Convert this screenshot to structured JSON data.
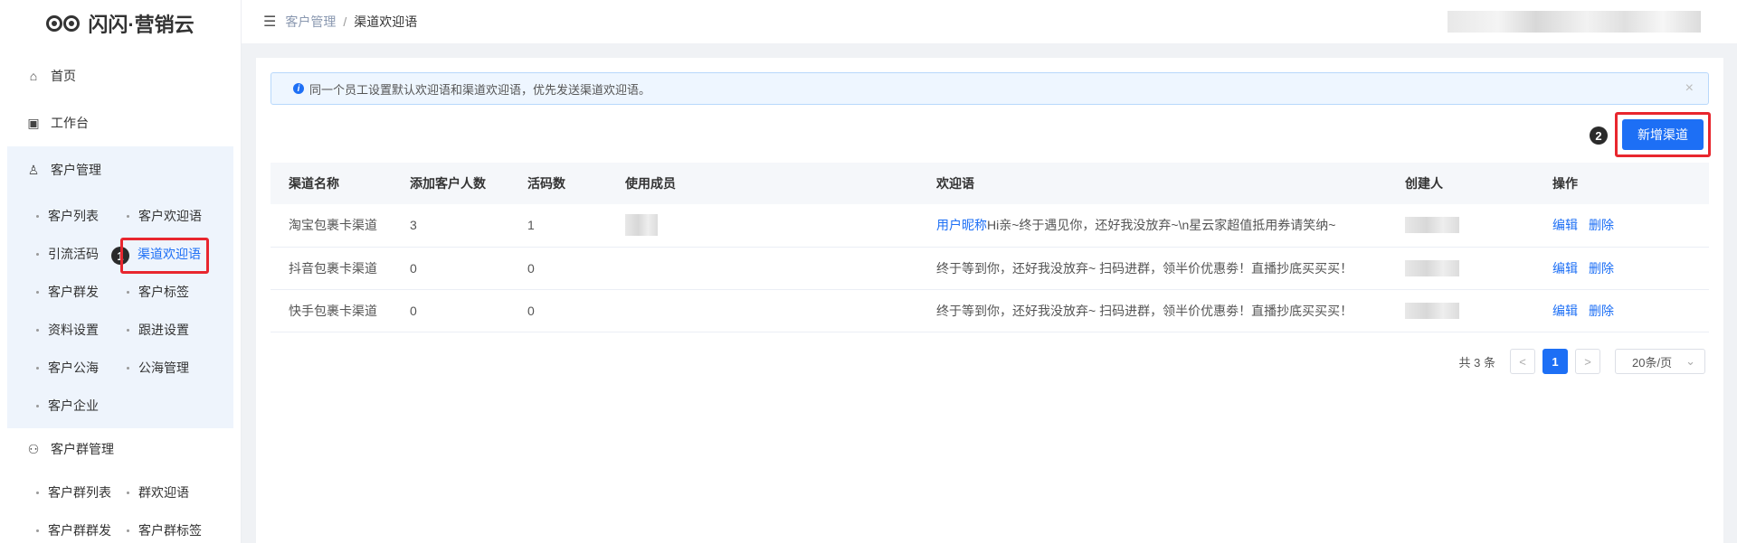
{
  "app": {
    "title": "闪闪·营销云"
  },
  "sidebar": {
    "home": "首页",
    "workbench": "工作台",
    "customer_mgmt": {
      "label": "客户管理",
      "items": [
        "客户列表",
        "客户欢迎语",
        "引流活码",
        "渠道欢迎语",
        "客户群发",
        "客户标签",
        "资料设置",
        "跟进设置",
        "客户公海",
        "公海管理",
        "客户企业"
      ]
    },
    "group_mgmt": {
      "label": "客户群管理",
      "items": [
        "客户群列表",
        "群欢迎语",
        "客户群群发",
        "客户群标签"
      ]
    },
    "step_badge": "1"
  },
  "header": {
    "breadcrumb_parent": "客户管理",
    "breadcrumb_sep": "/",
    "breadcrumb_current": "渠道欢迎语"
  },
  "alert": {
    "text": "同一个员工设置默认欢迎语和渠道欢迎语，优先发送渠道欢迎语。",
    "close": "×"
  },
  "toolbar": {
    "add_label": "新增渠道",
    "step_badge": "2"
  },
  "table": {
    "columns": [
      "渠道名称",
      "添加客户人数",
      "活码数",
      "使用成员",
      "欢迎语",
      "创建人",
      "操作"
    ],
    "rows": [
      {
        "name": "淘宝包裹卡渠道",
        "count": "3",
        "codes": "1",
        "nickname": "用户昵称",
        "greeting": "Hi亲~终于遇见你，还好我没放弃~\\n星云家超值抵用券请笑纳~",
        "edit": "编辑",
        "delete": "删除"
      },
      {
        "name": "抖音包裹卡渠道",
        "count": "0",
        "codes": "0",
        "nickname": "",
        "greeting": "终于等到你，还好我没放弃~ 扫码进群，领半价优惠劵！直播抄底买买买！",
        "edit": "编辑",
        "delete": "删除"
      },
      {
        "name": "快手包裹卡渠道",
        "count": "0",
        "codes": "0",
        "nickname": "",
        "greeting": "终于等到你，还好我没放弃~ 扫码进群，领半价优惠劵！直播抄底买买买！",
        "edit": "编辑",
        "delete": "删除"
      }
    ]
  },
  "pagination": {
    "total": "共 3 条",
    "prev": "<",
    "current": "1",
    "next": ">",
    "page_size": "20条/页",
    "chevron": "⌄"
  },
  "icons": {
    "home": "⌂",
    "workbench": "▣",
    "customer": "♙",
    "group": "⚇",
    "fold": "☰"
  },
  "colors": {
    "accent": "#1d6ff5",
    "highlight": "#e8262e"
  }
}
